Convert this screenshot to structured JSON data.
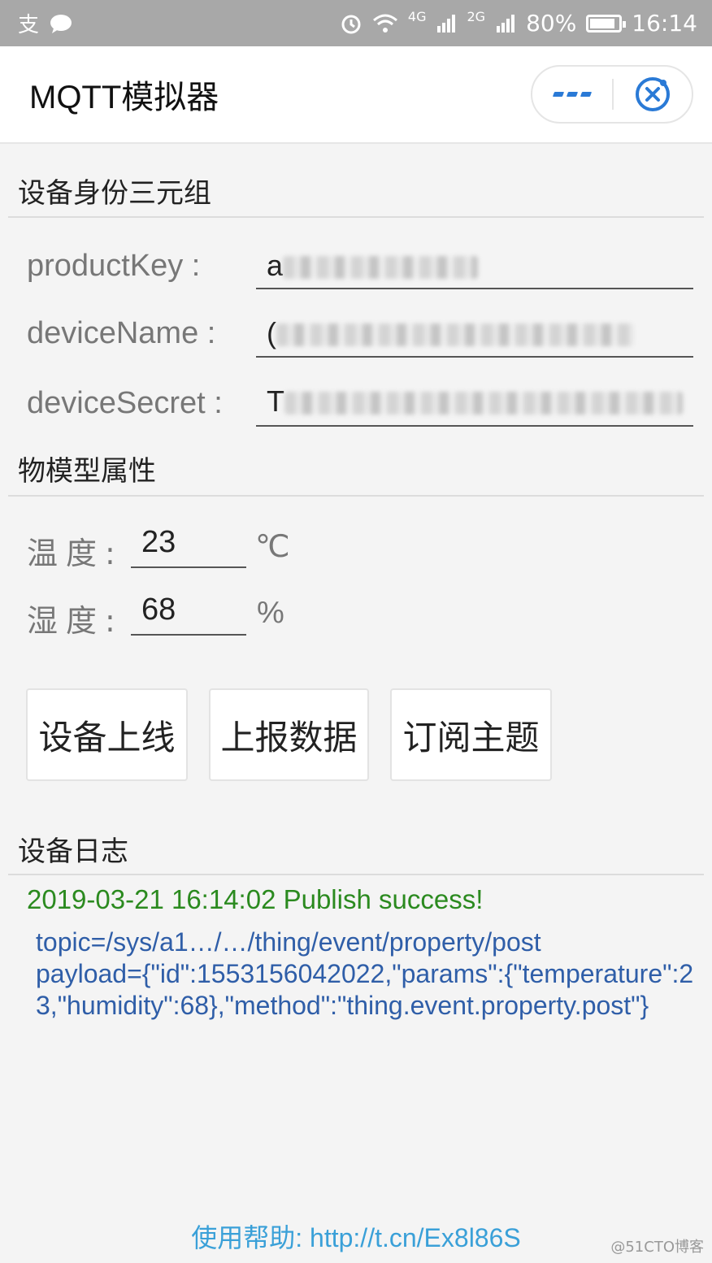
{
  "status_bar": {
    "left_icons": [
      "alipay-icon",
      "chat-icon"
    ],
    "right_icons": [
      "alarm-icon",
      "wifi-icon",
      "signal-4g-icon",
      "signal-2g-icon",
      "battery-icon"
    ],
    "net1": "4G",
    "net2": "2G",
    "battery": "80%",
    "time": "16:14"
  },
  "navbar": {
    "title": "MQTT模拟器",
    "more_icon": "more-dots-icon",
    "close_icon": "close-target-icon"
  },
  "identity": {
    "title": "设备身份三元组",
    "fields": [
      {
        "label": "productKey :",
        "value_prefix": "a"
      },
      {
        "label": "deviceName :",
        "value_prefix": "("
      },
      {
        "label": "deviceSecret :",
        "value_prefix": "T"
      }
    ]
  },
  "attributes": {
    "title": "物模型属性",
    "temperature": {
      "label": "温度:",
      "value": "23",
      "unit": "℃"
    },
    "humidity": {
      "label": "湿度:",
      "value": "68",
      "unit": "%"
    }
  },
  "buttons": {
    "online": "设备上线",
    "report": "上报数据",
    "subscribe": "订阅主题"
  },
  "log": {
    "title": "设备日志",
    "status": "2019-03-21 16:14:02 Publish success!",
    "body": "topic=/sys/a1…/…/thing/event/property/post\npayload={\"id\":1553156042022,\"params\":{\"temperature\":23,\"humidity\":68},\"method\":\"thing.event.property.post\"}"
  },
  "help": "使用帮助: http://t.cn/Ex8l86S",
  "watermark": "@51CTO博客",
  "colors": {
    "accent": "#2a7ad6",
    "success": "#2b8a1f",
    "log_text": "#2f5ea8",
    "link": "#3aa0d8"
  }
}
